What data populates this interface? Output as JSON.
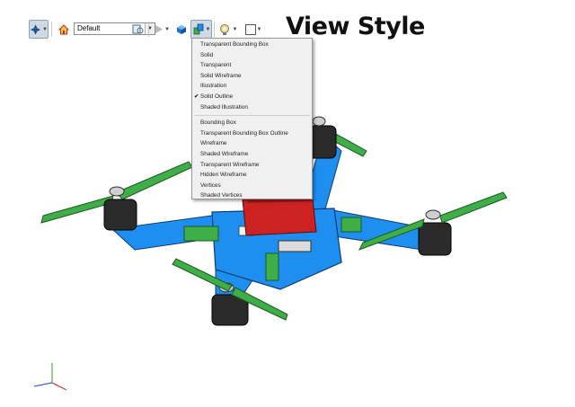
{
  "toolbar": {
    "view_name": "Default",
    "icons": [
      "view-orientation-icon",
      "home-view-icon",
      "named-view-icon",
      "play-icon",
      "solid-cube-icon",
      "view-style-icon",
      "lighting-icon",
      "background-color-icon"
    ]
  },
  "heading": "View Style",
  "view_style_menu": {
    "items_group1": [
      {
        "label": "Transparent Bounding Box",
        "checked": false
      },
      {
        "label": "Solid",
        "checked": false
      },
      {
        "label": "Transparent",
        "checked": false
      },
      {
        "label": "Solid Wireframe",
        "checked": false
      },
      {
        "label": "Illustration",
        "checked": false
      },
      {
        "label": "Solid Outline",
        "checked": true
      },
      {
        "label": "Shaded Illustration",
        "checked": false
      }
    ],
    "items_group2": [
      {
        "label": "Bounding Box"
      },
      {
        "label": "Transparent Bounding Box Outline"
      },
      {
        "label": "Wireframe"
      },
      {
        "label": "Shaded Wireframe"
      },
      {
        "label": "Transparent Wireframe"
      },
      {
        "label": "Hidden Wireframe"
      },
      {
        "label": "Vertices"
      },
      {
        "label": "Shaded Vertices"
      }
    ],
    "check_mark": "✔"
  },
  "colors": {
    "frame_blue": "#1e8ff0",
    "propeller_green": "#3fae49",
    "battery_red": "#cc2222",
    "motor_dark": "#2b2b2b"
  }
}
